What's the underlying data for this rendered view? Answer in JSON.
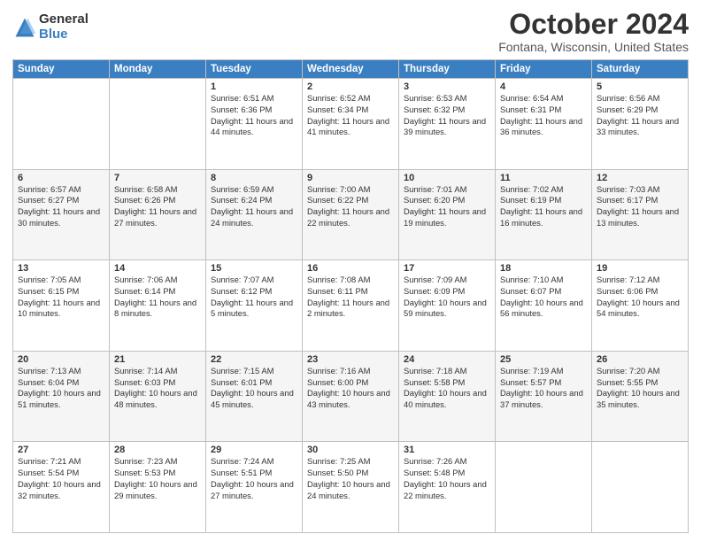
{
  "logo": {
    "general": "General",
    "blue": "Blue"
  },
  "title": "October 2024",
  "location": "Fontana, Wisconsin, United States",
  "days_of_week": [
    "Sunday",
    "Monday",
    "Tuesday",
    "Wednesday",
    "Thursday",
    "Friday",
    "Saturday"
  ],
  "weeks": [
    [
      {
        "day": "",
        "sunrise": "",
        "sunset": "",
        "daylight": ""
      },
      {
        "day": "",
        "sunrise": "",
        "sunset": "",
        "daylight": ""
      },
      {
        "day": "1",
        "sunrise": "Sunrise: 6:51 AM",
        "sunset": "Sunset: 6:36 PM",
        "daylight": "Daylight: 11 hours and 44 minutes."
      },
      {
        "day": "2",
        "sunrise": "Sunrise: 6:52 AM",
        "sunset": "Sunset: 6:34 PM",
        "daylight": "Daylight: 11 hours and 41 minutes."
      },
      {
        "day": "3",
        "sunrise": "Sunrise: 6:53 AM",
        "sunset": "Sunset: 6:32 PM",
        "daylight": "Daylight: 11 hours and 39 minutes."
      },
      {
        "day": "4",
        "sunrise": "Sunrise: 6:54 AM",
        "sunset": "Sunset: 6:31 PM",
        "daylight": "Daylight: 11 hours and 36 minutes."
      },
      {
        "day": "5",
        "sunrise": "Sunrise: 6:56 AM",
        "sunset": "Sunset: 6:29 PM",
        "daylight": "Daylight: 11 hours and 33 minutes."
      }
    ],
    [
      {
        "day": "6",
        "sunrise": "Sunrise: 6:57 AM",
        "sunset": "Sunset: 6:27 PM",
        "daylight": "Daylight: 11 hours and 30 minutes."
      },
      {
        "day": "7",
        "sunrise": "Sunrise: 6:58 AM",
        "sunset": "Sunset: 6:26 PM",
        "daylight": "Daylight: 11 hours and 27 minutes."
      },
      {
        "day": "8",
        "sunrise": "Sunrise: 6:59 AM",
        "sunset": "Sunset: 6:24 PM",
        "daylight": "Daylight: 11 hours and 24 minutes."
      },
      {
        "day": "9",
        "sunrise": "Sunrise: 7:00 AM",
        "sunset": "Sunset: 6:22 PM",
        "daylight": "Daylight: 11 hours and 22 minutes."
      },
      {
        "day": "10",
        "sunrise": "Sunrise: 7:01 AM",
        "sunset": "Sunset: 6:20 PM",
        "daylight": "Daylight: 11 hours and 19 minutes."
      },
      {
        "day": "11",
        "sunrise": "Sunrise: 7:02 AM",
        "sunset": "Sunset: 6:19 PM",
        "daylight": "Daylight: 11 hours and 16 minutes."
      },
      {
        "day": "12",
        "sunrise": "Sunrise: 7:03 AM",
        "sunset": "Sunset: 6:17 PM",
        "daylight": "Daylight: 11 hours and 13 minutes."
      }
    ],
    [
      {
        "day": "13",
        "sunrise": "Sunrise: 7:05 AM",
        "sunset": "Sunset: 6:15 PM",
        "daylight": "Daylight: 11 hours and 10 minutes."
      },
      {
        "day": "14",
        "sunrise": "Sunrise: 7:06 AM",
        "sunset": "Sunset: 6:14 PM",
        "daylight": "Daylight: 11 hours and 8 minutes."
      },
      {
        "day": "15",
        "sunrise": "Sunrise: 7:07 AM",
        "sunset": "Sunset: 6:12 PM",
        "daylight": "Daylight: 11 hours and 5 minutes."
      },
      {
        "day": "16",
        "sunrise": "Sunrise: 7:08 AM",
        "sunset": "Sunset: 6:11 PM",
        "daylight": "Daylight: 11 hours and 2 minutes."
      },
      {
        "day": "17",
        "sunrise": "Sunrise: 7:09 AM",
        "sunset": "Sunset: 6:09 PM",
        "daylight": "Daylight: 10 hours and 59 minutes."
      },
      {
        "day": "18",
        "sunrise": "Sunrise: 7:10 AM",
        "sunset": "Sunset: 6:07 PM",
        "daylight": "Daylight: 10 hours and 56 minutes."
      },
      {
        "day": "19",
        "sunrise": "Sunrise: 7:12 AM",
        "sunset": "Sunset: 6:06 PM",
        "daylight": "Daylight: 10 hours and 54 minutes."
      }
    ],
    [
      {
        "day": "20",
        "sunrise": "Sunrise: 7:13 AM",
        "sunset": "Sunset: 6:04 PM",
        "daylight": "Daylight: 10 hours and 51 minutes."
      },
      {
        "day": "21",
        "sunrise": "Sunrise: 7:14 AM",
        "sunset": "Sunset: 6:03 PM",
        "daylight": "Daylight: 10 hours and 48 minutes."
      },
      {
        "day": "22",
        "sunrise": "Sunrise: 7:15 AM",
        "sunset": "Sunset: 6:01 PM",
        "daylight": "Daylight: 10 hours and 45 minutes."
      },
      {
        "day": "23",
        "sunrise": "Sunrise: 7:16 AM",
        "sunset": "Sunset: 6:00 PM",
        "daylight": "Daylight: 10 hours and 43 minutes."
      },
      {
        "day": "24",
        "sunrise": "Sunrise: 7:18 AM",
        "sunset": "Sunset: 5:58 PM",
        "daylight": "Daylight: 10 hours and 40 minutes."
      },
      {
        "day": "25",
        "sunrise": "Sunrise: 7:19 AM",
        "sunset": "Sunset: 5:57 PM",
        "daylight": "Daylight: 10 hours and 37 minutes."
      },
      {
        "day": "26",
        "sunrise": "Sunrise: 7:20 AM",
        "sunset": "Sunset: 5:55 PM",
        "daylight": "Daylight: 10 hours and 35 minutes."
      }
    ],
    [
      {
        "day": "27",
        "sunrise": "Sunrise: 7:21 AM",
        "sunset": "Sunset: 5:54 PM",
        "daylight": "Daylight: 10 hours and 32 minutes."
      },
      {
        "day": "28",
        "sunrise": "Sunrise: 7:23 AM",
        "sunset": "Sunset: 5:53 PM",
        "daylight": "Daylight: 10 hours and 29 minutes."
      },
      {
        "day": "29",
        "sunrise": "Sunrise: 7:24 AM",
        "sunset": "Sunset: 5:51 PM",
        "daylight": "Daylight: 10 hours and 27 minutes."
      },
      {
        "day": "30",
        "sunrise": "Sunrise: 7:25 AM",
        "sunset": "Sunset: 5:50 PM",
        "daylight": "Daylight: 10 hours and 24 minutes."
      },
      {
        "day": "31",
        "sunrise": "Sunrise: 7:26 AM",
        "sunset": "Sunset: 5:48 PM",
        "daylight": "Daylight: 10 hours and 22 minutes."
      },
      {
        "day": "",
        "sunrise": "",
        "sunset": "",
        "daylight": ""
      },
      {
        "day": "",
        "sunrise": "",
        "sunset": "",
        "daylight": ""
      }
    ]
  ]
}
